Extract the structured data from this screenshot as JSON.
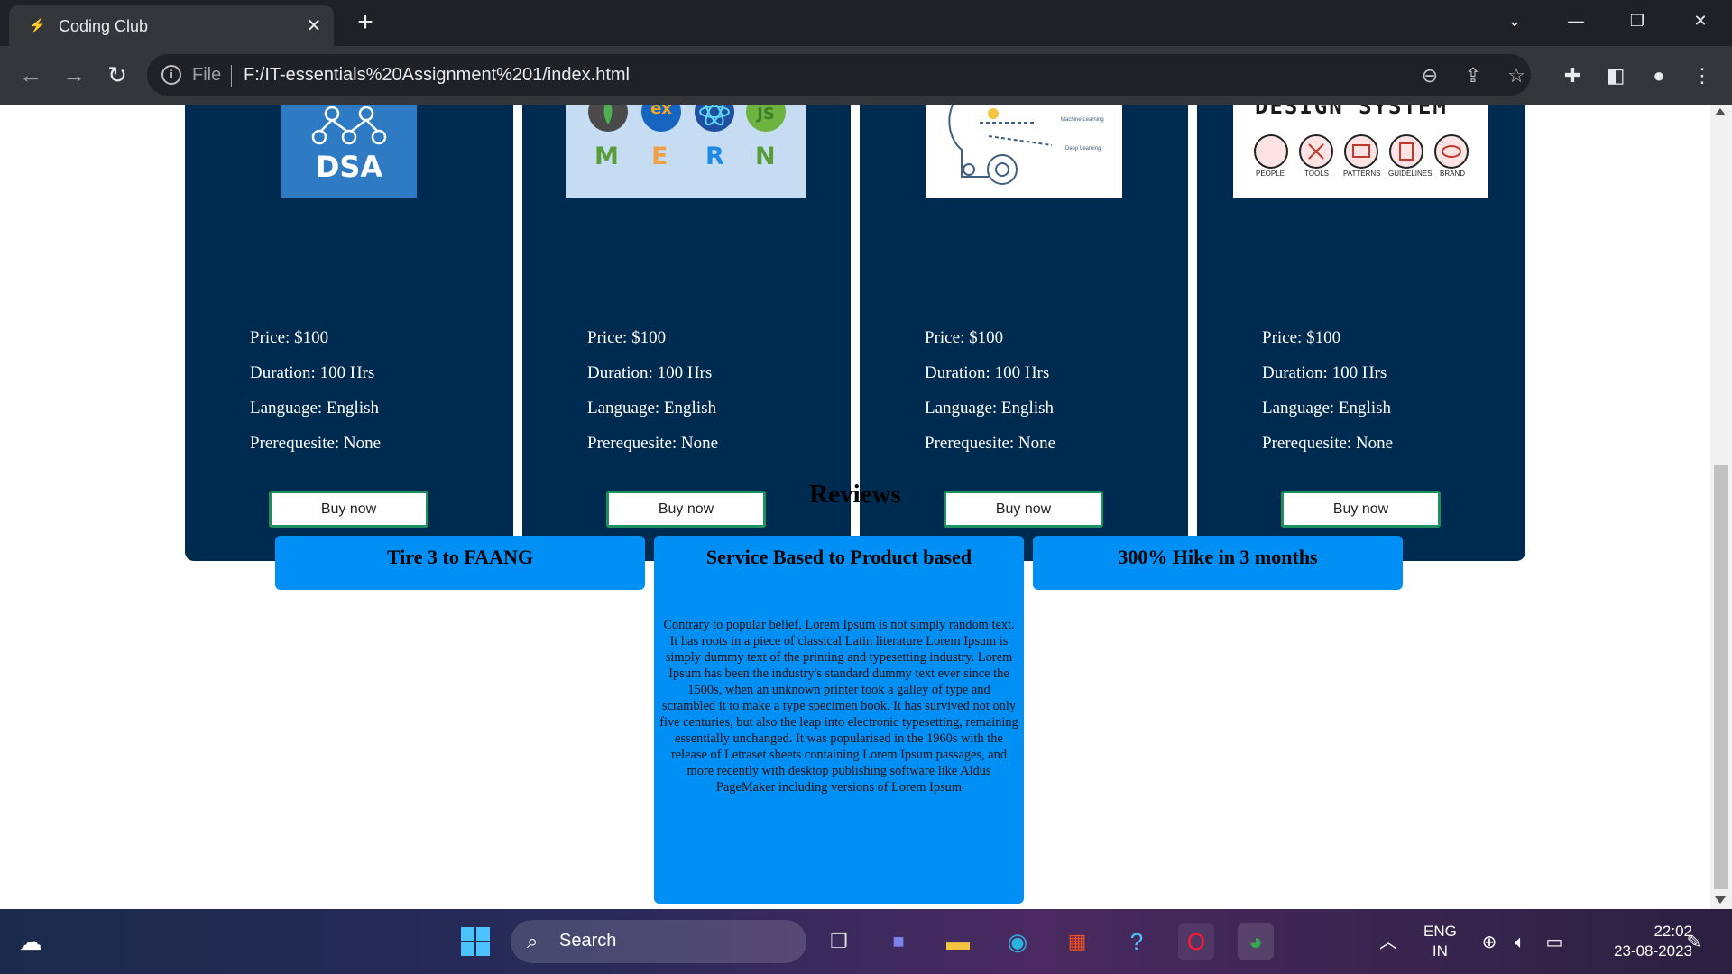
{
  "browser": {
    "tab_title": "Coding Club",
    "address_scheme": "File",
    "address_url": "F:/IT-essentials%20Assignment%201/index.html"
  },
  "cards": [
    {
      "image_text": "DSA",
      "image_alt_icon": "dsa-tree-icon",
      "price": "Price: $100",
      "duration": "Duration: 100 Hrs",
      "language": "Language: English",
      "prerequisite": "Prerequesite: None",
      "button": "Buy now"
    },
    {
      "image_letters": [
        "M",
        "E",
        "R",
        "N"
      ],
      "image_badges": [
        "ex"
      ],
      "price": "Price: $100",
      "duration": "Duration: 100 Hrs",
      "language": "Language: English",
      "prerequisite": "Prerequesite: None",
      "button": "Buy now"
    },
    {
      "image_labels": [
        "Machine Learning",
        "Deep Learning"
      ],
      "price": "Price: $100",
      "duration": "Duration: 100 Hrs",
      "language": "Language: English",
      "prerequisite": "Prerequesite: None",
      "button": "Buy now"
    },
    {
      "image_header": "DESIGN SYSTEM",
      "image_labels": [
        "PEOPLE",
        "TOOLS",
        "PATTERNS",
        "GUIDELINES",
        "BRAND"
      ],
      "price": "Price: $100",
      "duration": "Duration: 100 Hrs",
      "language": "Language: English",
      "prerequisite": "Prerequesite: None",
      "button": "Buy now"
    }
  ],
  "reviews": {
    "title": "Reviews",
    "items": [
      {
        "heading": "Tire 3 to FAANG"
      },
      {
        "heading": "Service Based to Product based",
        "body": "Contrary to popular belief, Lorem Ipsum is not simply random text. It has roots in a piece of classical Latin literature Lorem Ipsum is simply dummy text of the printing and typesetting industry. Lorem Ipsum has been the industry's standard dummy text ever since the 1500s, when an unknown printer took a galley of type and scrambled it to make a type specimen book. It has survived not only five centuries, but also the leap into electronic typesetting, remaining essentially unchanged. It was popularised in the 1960s with the release of Letraset sheets containing Lorem Ipsum passages, and more recently with desktop publishing software like Aldus PageMaker including versions of Lorem Ipsum"
      },
      {
        "heading": "300% Hike in 3 months"
      }
    ]
  },
  "taskbar": {
    "search_label": "Search",
    "lang_top": "ENG",
    "lang_bottom": "IN",
    "time": "22:02",
    "date": "23-08-2023"
  },
  "colors": {
    "card_bg": "#002b50",
    "review_bg": "#0090f5",
    "button_border": "#1e8f5e"
  }
}
